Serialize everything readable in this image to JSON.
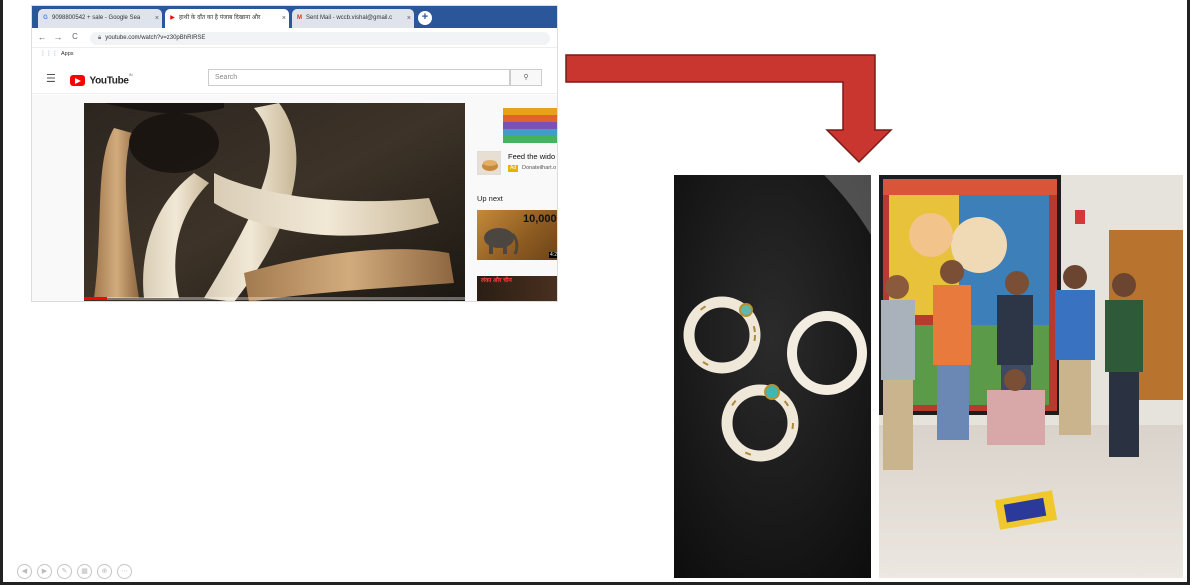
{
  "browser": {
    "tabs": [
      {
        "label": "9098800542 + sale - Google Sea",
        "favicon": "G",
        "favicon_color": "#4285f4",
        "active": false
      },
      {
        "label": "हाथी के दाँत का है पंजाब दिखाना और",
        "favicon": "▶",
        "favicon_color": "#ff0000",
        "active": true
      },
      {
        "label": "Sent Mail - wccb.vishal@gmail.c",
        "favicon": "M",
        "favicon_color": "#d93025",
        "active": false
      }
    ],
    "new_tab_label": "+",
    "close_glyph": "×",
    "nav": {
      "back": "←",
      "forward": "→",
      "reload": "C"
    },
    "url": "youtube.com/watch?v=z30pBhRIRSE",
    "bookmarks_label": "Apps"
  },
  "youtube": {
    "logo_text": "YouTube",
    "logo_suffix": "IN",
    "search_placeholder": "Search",
    "search_button": "Q",
    "ad_title": "Feed the wido",
    "ad_badge": "Ad",
    "ad_source": "Donateilhart.o",
    "up_next_label": "Up next",
    "next_video_1_text": "10,000",
    "next_video_1_duration": "4:2",
    "next_video_2_text": "लंका और चीन",
    "player_progress": 0.06
  },
  "colors": {
    "arrow_fill": "#c8362f",
    "arrow_stroke": "#7a1a16",
    "youtube_red": "#ff0000",
    "tab_bar": "#2b579a"
  },
  "slideshow_controls": [
    {
      "name": "previous-icon",
      "glyph": "◀"
    },
    {
      "name": "next-icon",
      "glyph": "▶"
    },
    {
      "name": "pen-icon",
      "glyph": "✎"
    },
    {
      "name": "slides-icon",
      "glyph": "▦"
    },
    {
      "name": "zoom-icon",
      "glyph": "⊕"
    },
    {
      "name": "more-icon",
      "glyph": "⋯"
    }
  ]
}
